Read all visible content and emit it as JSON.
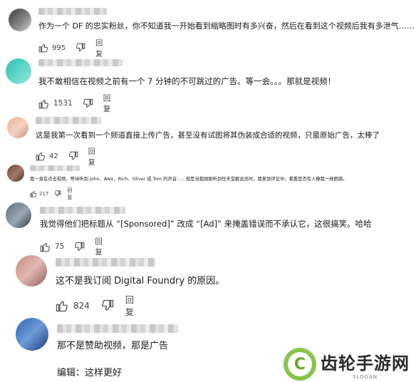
{
  "comments": [
    {
      "text": "作为一个 DF 的忠实粉丝，你不知道我一开始看到缩略图时有多兴奋，然后在看到这个视频后我有多泄气……",
      "likes": "995",
      "reply": "回复"
    },
    {
      "text": "我不敢相信在视频之前有一个 7 分钟的不可跳过的广告。等一会。。。那就是视频！",
      "likes": "1531",
      "reply": "回复"
    },
    {
      "text": "这是我第一次看到一个频道直接上传广告，甚至没有试图将其伪装成合适的视频，只是原始广告，太棒了",
      "likes": "42",
      "reply": "回复"
    },
    {
      "text": "我一直在点击视频，等待听到 John、Alex、Rich、Oliver 或 Tom 的声音……但是当我刚刚听到任天堂解说员时，我来到评论中，看看是否有人像我一样困惑。",
      "likes": "217",
      "reply": "回复"
    },
    {
      "text": "我觉得他们把标题从 “[Sponsored]” 改成 “[Ad]” 来掩盖错误而不承认它，这很搞笑。哈哈",
      "likes": "75",
      "reply": "回复"
    },
    {
      "text": "这不是我订阅 Digital Foundry 的原因。",
      "likes": "824",
      "reply": "回复"
    },
    {
      "text": "那不是赞助视频，那是广告",
      "text2": "编辑：这样更好"
    }
  ],
  "watermark": {
    "title": "齿轮手游网",
    "slogan": "SLOGAN",
    "mark": "C"
  },
  "colors": {
    "logo_green": "#8bc34a"
  }
}
